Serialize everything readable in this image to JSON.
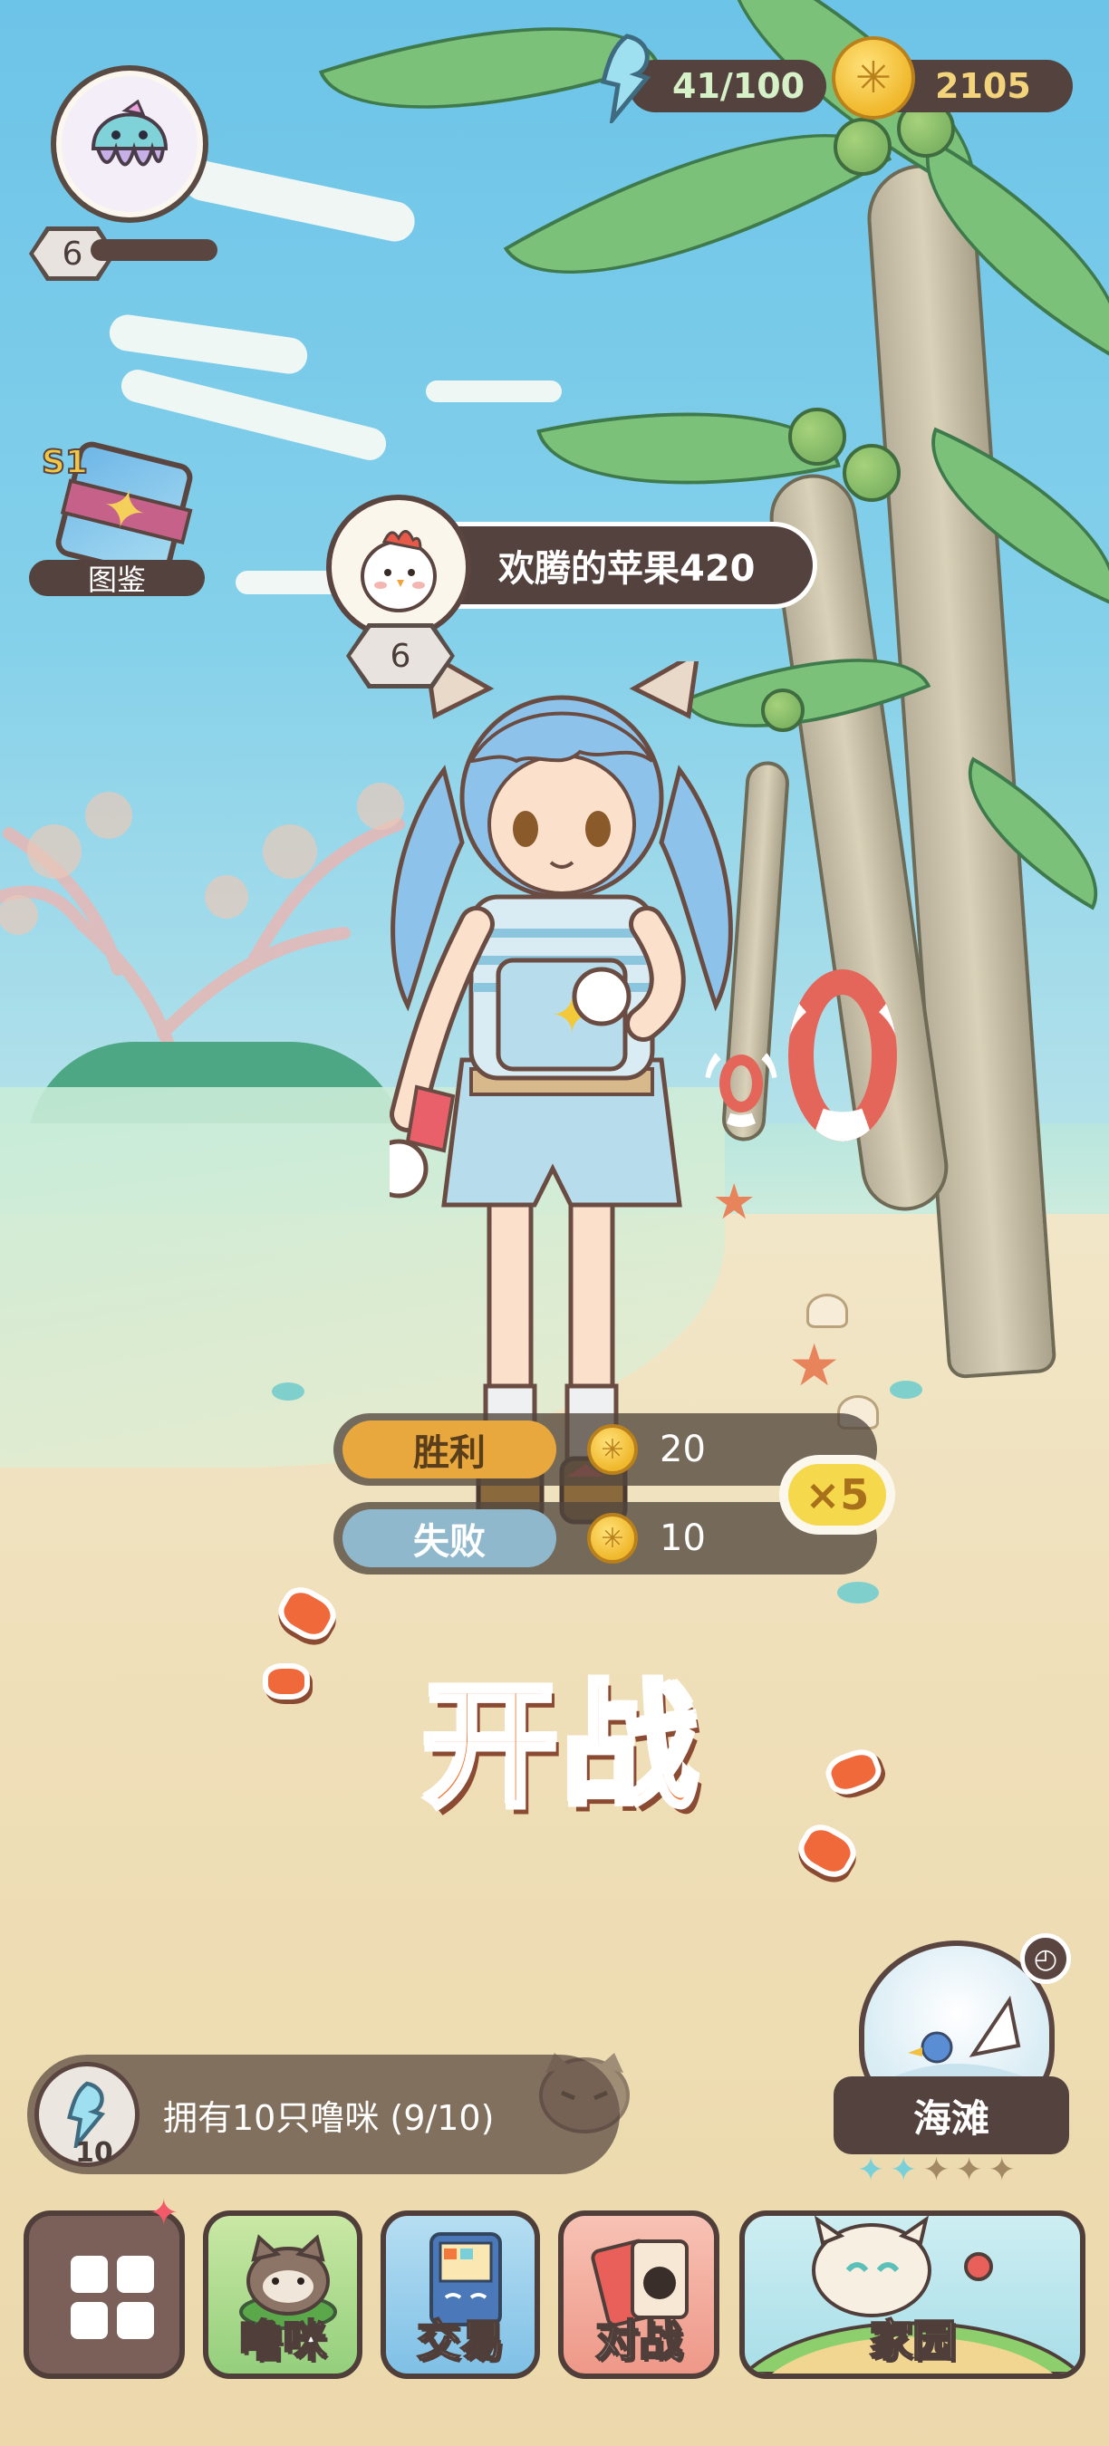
{
  "player": {
    "level": "6"
  },
  "resources": {
    "energy": "41/100",
    "coins": "2105"
  },
  "codex": {
    "season": "S1",
    "label": "图鉴"
  },
  "opponent": {
    "name": "欢腾的苹果420",
    "level": "6"
  },
  "rewards": {
    "win": {
      "label": "胜利",
      "coins": "20"
    },
    "lose": {
      "label": "失败",
      "coins": "10"
    },
    "multiplier": "×5"
  },
  "fight_label": "开战",
  "mission": {
    "text": "拥有10只噜咪 (9/10)",
    "count": "10"
  },
  "location": {
    "name": "海滩",
    "stars_filled": 2,
    "stars_total": 5
  },
  "dock": {
    "menu_label": "",
    "pets_label": "噜咪",
    "trade_label": "交易",
    "battle_label": "对战",
    "home_label": "家园"
  },
  "colors": {
    "accent": "#f27a3c",
    "win": "#e8a83e",
    "lose": "#8fb8cc",
    "panel": "#54423e"
  }
}
